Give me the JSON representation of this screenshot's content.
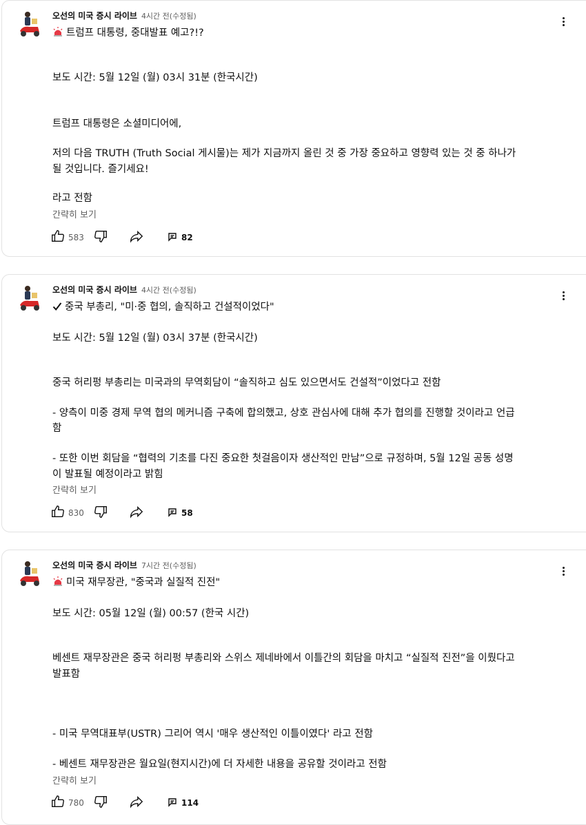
{
  "posts": [
    {
      "author": "오선의 미국 증시 라이브",
      "time": "4시간 전(수정됨)",
      "title_icon": "siren-icon",
      "title": "트럼프 대통령, 중대발표 예고?!?",
      "lines": [
        "보도 시간: 5월 12일 (월) 03시 31분 (한국시간)",
        "트럼프 대통령은 소셜미디어에,",
        "저의 다음 TRUTH (Truth Social 게시물)는 제가 지금까지 올린 것 중 가장 중요하고 영향력 있는 것 중 하나가",
        "될 것입니다. 즐기세요!",
        "라고 전함"
      ],
      "read_less": "간략히 보기",
      "likes": "583",
      "comments": "82"
    },
    {
      "author": "오선의 미국 증시 라이브",
      "time": "4시간 전(수정됨)",
      "title_icon": "checkmark-icon",
      "title": "중국 부총리, \"미·중 협의, 솔직하고 건설적이었다\"",
      "lines": [
        "보도 시간: 5월 12일 (월) 03시 37분 (한국시간)",
        "중국 허리펑 부총리는 미국과의 무역회담이 “솔직하고 심도 있으면서도 건설적”이었다고 전함",
        "- 양측이 미중 경제 무역 협의 메커니즘 구축에 합의했고, 상호 관심사에 대해 추가 협의를 진행할 것이라고 언급",
        "함",
        "- 또한 이번 회담을 “협력의 기초를 다진 중요한 첫걸음이자 생산적인 만남”으로 규정하며, 5월 12일 공동 성명",
        "이 발표될 예정이라고 밝힘"
      ],
      "read_less": "간략히 보기",
      "likes": "830",
      "comments": "58"
    },
    {
      "author": "오선의 미국 증시 라이브",
      "time": "7시간 전(수정됨)",
      "title_icon": "siren-icon",
      "title": "미국 재무장관, \"중국과 실질적 진전\"",
      "lines": [
        "보도 시간: 05월 12일 (월) 00:57 (한국 시간)",
        "베센트 재무장관은 중국 허리펑 부총리와 스위스 제네바에서 이틀간의 회담을 마치고 “실질적 진전”을 이뤘다고",
        "발표함",
        "- 미국 무역대표부(USTR) 그리어 역시 '매우 생산적인 이틀이였다' 라고 전함",
        "- 베센트 재무장관은 월요일(현지시간)에 더 자세한 내용을 공유할 것이라고 전함"
      ],
      "read_less": "간략히 보기",
      "likes": "780",
      "comments": "114"
    }
  ]
}
